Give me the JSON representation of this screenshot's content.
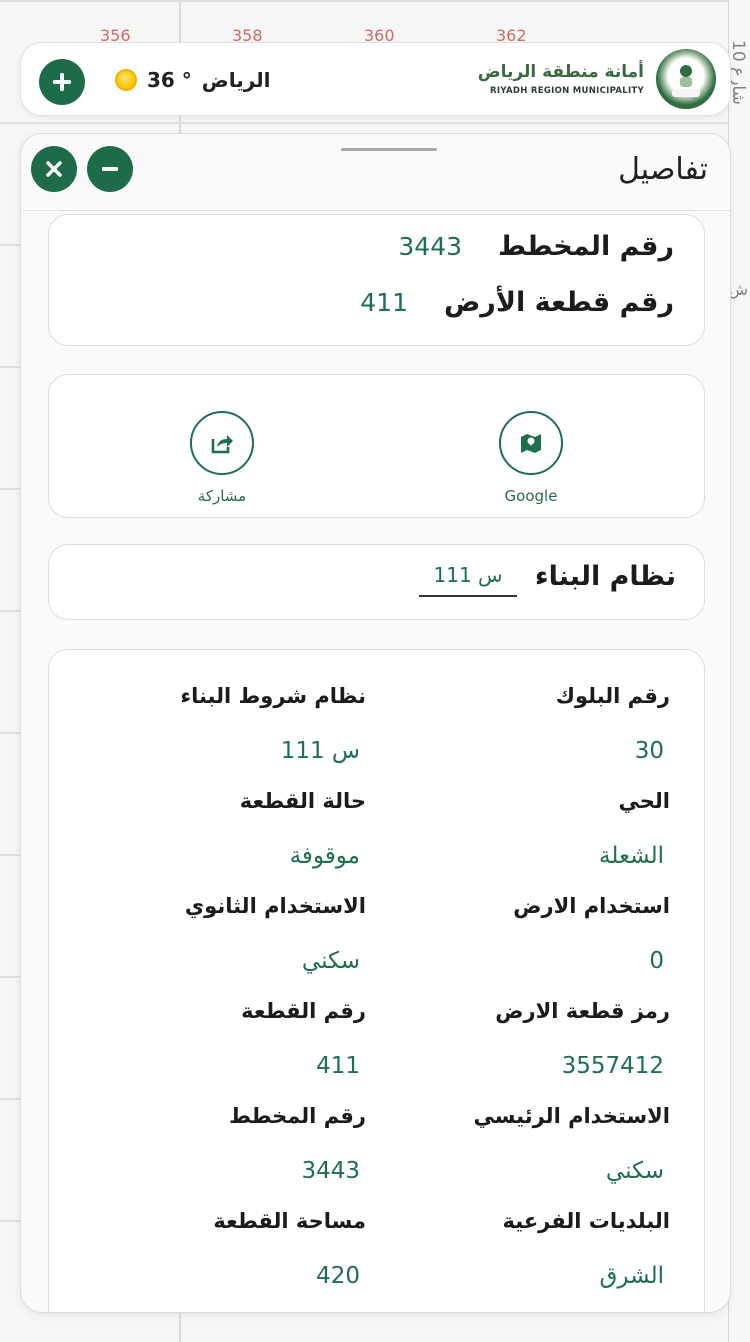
{
  "map": {
    "numbers": [
      "356",
      "358",
      "360",
      "362"
    ],
    "side_text": "شارع 10",
    "side_char": "ش"
  },
  "header": {
    "city": "الرياض",
    "temperature": "36 °",
    "logo_ar": "أمانة منطقة الرياض",
    "logo_en": "RIYADH REGION MUNICIPALITY"
  },
  "panel": {
    "title": "تفاصيل"
  },
  "summary": {
    "plan_label": "رقم المخطط",
    "plan_value": "3443",
    "parcel_label": "رقم قطعة الأرض",
    "parcel_value": "411"
  },
  "actions": {
    "google_label": "Google",
    "share_label": "مشاركة"
  },
  "building_system": {
    "label": "نظام البناء",
    "value": "س 111"
  },
  "details": [
    {
      "label": "رقم البلوك",
      "value": "30"
    },
    {
      "label": "نظام شروط البناء",
      "value": "س 111"
    },
    {
      "label": "الحي",
      "value": "الشعلة"
    },
    {
      "label": "حالة القطعة",
      "value": "موقوفة"
    },
    {
      "label": "استخدام الارض",
      "value": "0"
    },
    {
      "label": "الاستخدام الثانوي",
      "value": "سكني"
    },
    {
      "label": "رمز قطعة الارض",
      "value": "3557412"
    },
    {
      "label": "رقم القطعة",
      "value": "411"
    },
    {
      "label": "الاستخدام الرئيسي",
      "value": "سكني"
    },
    {
      "label": "رقم المخطط",
      "value": "3443"
    },
    {
      "label": "البلديات الفرعية",
      "value": "الشرق"
    },
    {
      "label": "مساحة القطعة",
      "value": "420"
    }
  ],
  "colors": {
    "brand_green": "#1e6b4a",
    "value_green": "#1f6f4e"
  }
}
